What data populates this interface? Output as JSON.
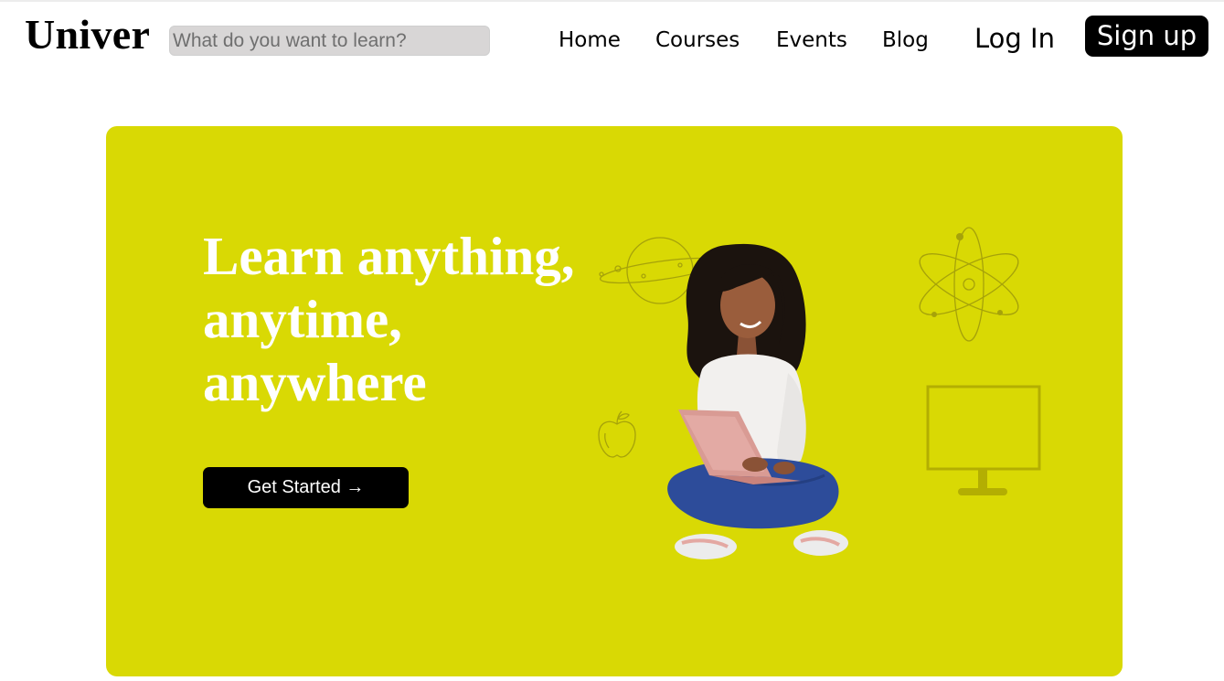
{
  "header": {
    "logo": "Univer",
    "search": {
      "placeholder": "What do you want to learn?",
      "value": ""
    },
    "nav": [
      {
        "label": "Home"
      },
      {
        "label": "Courses"
      },
      {
        "label": "Events"
      },
      {
        "label": "Blog"
      }
    ],
    "login_label": "Log In",
    "signup_label": "Sign up"
  },
  "hero": {
    "headline_lines": [
      "Learn anything,",
      "anytime,",
      "anywhere"
    ],
    "cta_label": "Get Started →",
    "illustrations": [
      "planet-icon",
      "atom-icon",
      "apple-icon",
      "monitor-icon",
      "student-with-laptop"
    ]
  },
  "colors": {
    "hero_background": "#d9d904",
    "headline": "#ffffff",
    "button": "#000000",
    "search_background": "#d8d6d6"
  }
}
